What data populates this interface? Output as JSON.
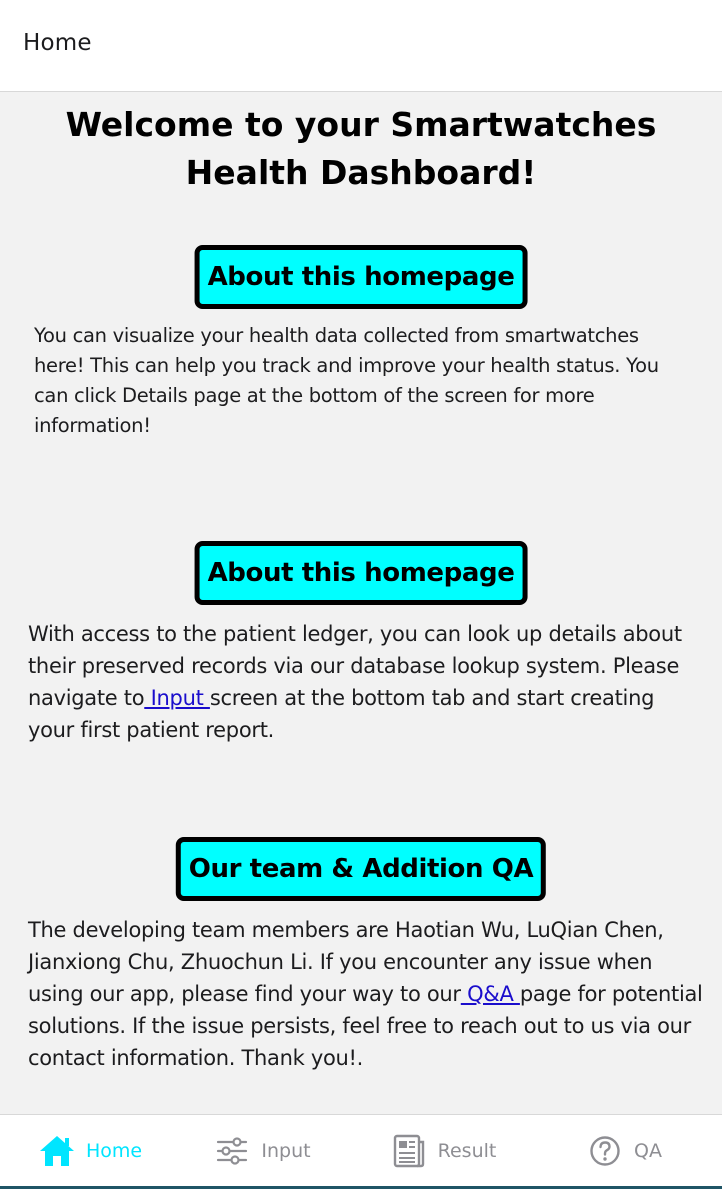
{
  "header": {
    "title": "Home"
  },
  "main": {
    "welcome": "Welcome to your Smartwatches Health Dashboard!",
    "sections": [
      {
        "title": "About this homepage",
        "text": "You can visualize your health data collected from smartwatches here! This can help you track and improve your health status. You can click Details page at the bottom of the screen for more information!"
      },
      {
        "title": "About this homepage",
        "text_before": "With access to the patient ledger, you can look up details about their preserved records via our database lookup system. Please navigate to",
        "link": " Input ",
        "text_after": "screen at the bottom tab and start creating your first patient report."
      },
      {
        "title": "Our team & Addition QA",
        "text_before": "The developing team members are Haotian Wu, LuQian Chen, Jianxiong Chu, Zhuochun Li. If you encounter any issue when using our app, please find your way to our",
        "link": " Q&A  ",
        "text_after": "page for potential solutions. If the issue persists, feel free to reach out to us via our contact information. Thank you!."
      }
    ]
  },
  "tabs": [
    {
      "label": "Home",
      "icon": "home-icon",
      "active": true
    },
    {
      "label": "Input",
      "icon": "sliders-icon",
      "active": false
    },
    {
      "label": "Result",
      "icon": "document-icon",
      "active": false
    },
    {
      "label": "QA",
      "icon": "help-circle-icon",
      "active": false
    }
  ],
  "colors": {
    "accent": "#00e5ff",
    "section_bg": "#00ffff",
    "link": "#1a0dcc",
    "inactive": "#8e8e93"
  }
}
